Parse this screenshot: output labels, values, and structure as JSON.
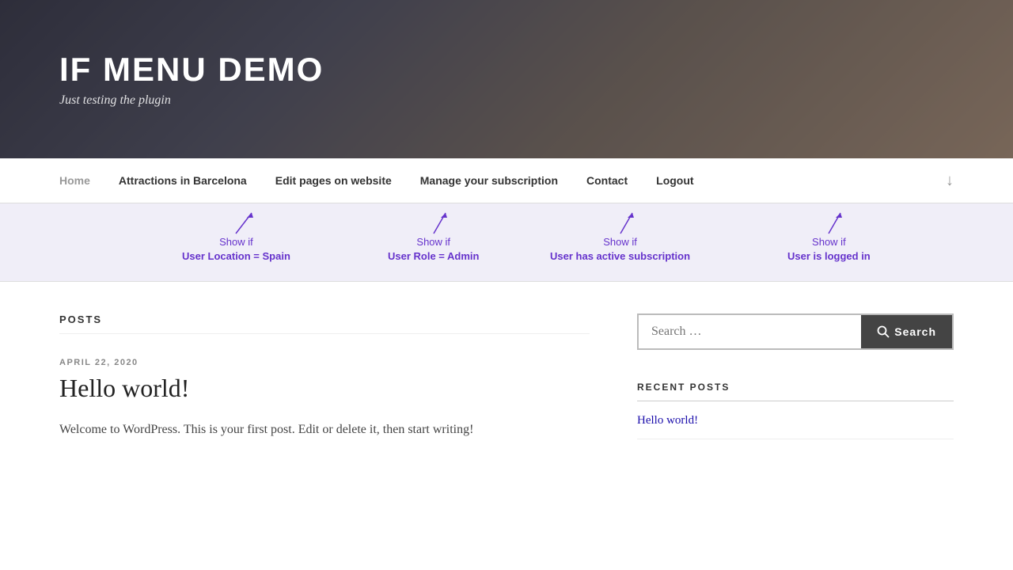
{
  "hero": {
    "title": "IF MENU DEMO",
    "subtitle": "Just testing the plugin"
  },
  "nav": {
    "items": [
      {
        "id": "home",
        "label": "Home",
        "muted": true
      },
      {
        "id": "attractions",
        "label": "Attractions in Barcelona",
        "muted": false
      },
      {
        "id": "edit-pages",
        "label": "Edit pages on website",
        "muted": false
      },
      {
        "id": "manage-subscription",
        "label": "Manage your subscription",
        "muted": false
      },
      {
        "id": "contact",
        "label": "Contact",
        "muted": false
      },
      {
        "id": "logout",
        "label": "Logout",
        "muted": false
      }
    ]
  },
  "annotations": [
    {
      "id": "ann-location",
      "line1": "Show if",
      "line2": "User Location = Spain"
    },
    {
      "id": "ann-role",
      "line1": "Show if",
      "line2": "User Role = Admin"
    },
    {
      "id": "ann-subscription",
      "line1": "Show if",
      "line2": "User has active subscription"
    },
    {
      "id": "ann-logged-in",
      "line1": "Show if",
      "line2": "User is logged in"
    }
  ],
  "posts": {
    "section_label": "POSTS",
    "items": [
      {
        "id": "post-1",
        "date": "APRIL 22, 2020",
        "title": "Hello world!",
        "body": "Welcome to WordPress. This is your first post. Edit or delete it, then start writing!"
      }
    ]
  },
  "sidebar": {
    "search_placeholder": "Search …",
    "search_button_label": "Search",
    "recent_posts_label": "RECENT POSTS",
    "recent_posts": [
      {
        "id": "rp-1",
        "title": "Hello world!"
      }
    ]
  }
}
